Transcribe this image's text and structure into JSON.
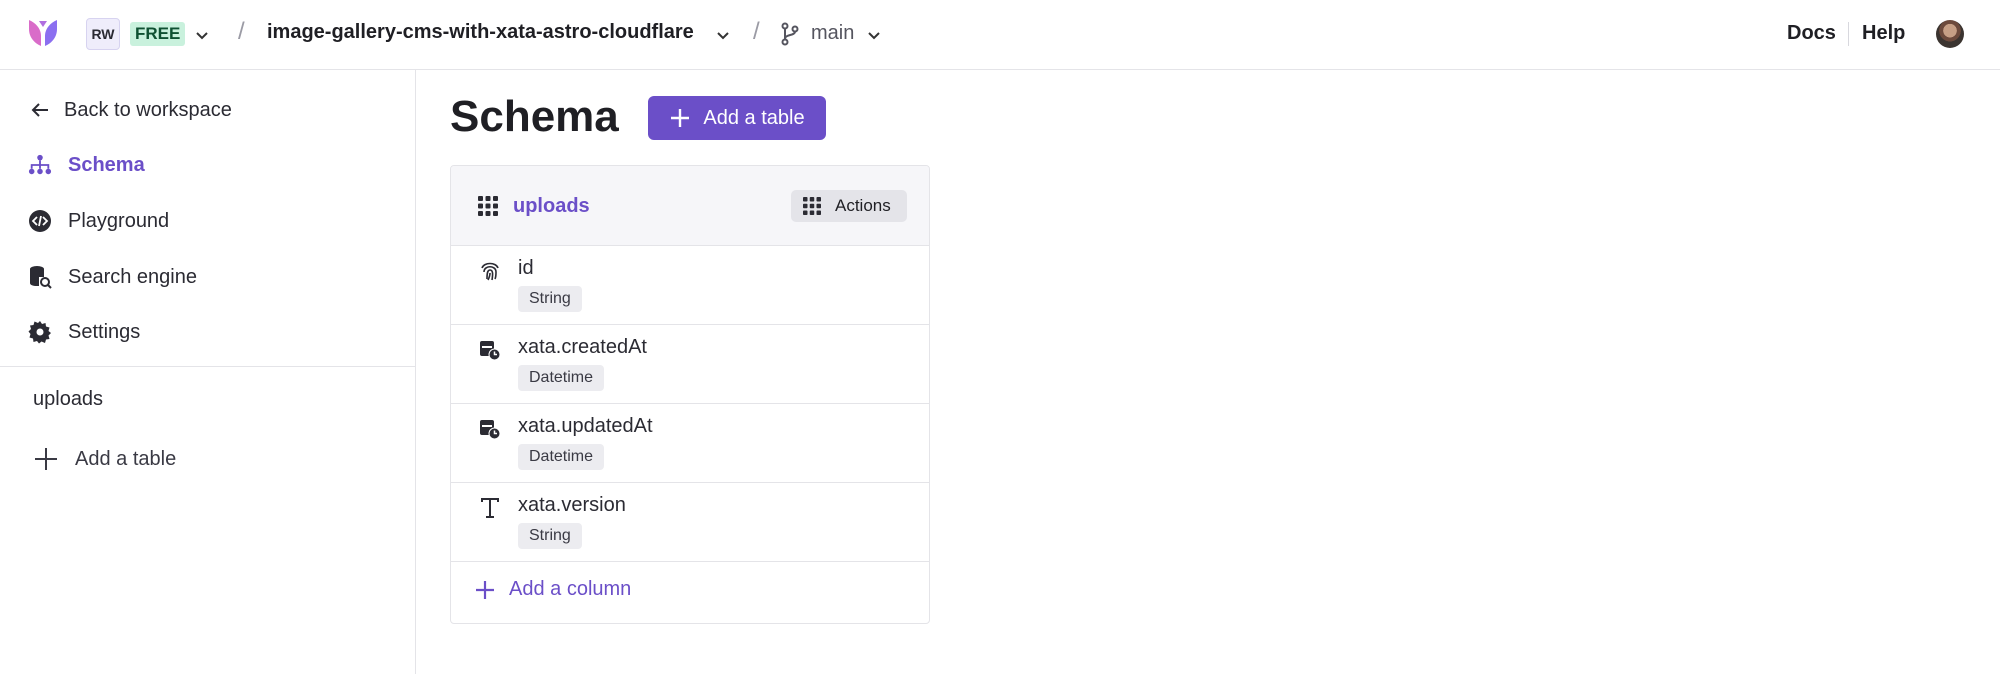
{
  "topbar": {
    "workspace_initials": "RW",
    "plan": "FREE",
    "separator": "/",
    "database": "image-gallery-cms-with-xata-astro-cloudflare",
    "branch": "main",
    "docs": "Docs",
    "help": "Help"
  },
  "sidebar": {
    "back": "Back to workspace",
    "items": [
      {
        "label": "Schema",
        "icon": "schema-icon"
      },
      {
        "label": "Playground",
        "icon": "code-icon"
      },
      {
        "label": "Search engine",
        "icon": "database-search-icon"
      },
      {
        "label": "Settings",
        "icon": "gear-icon"
      }
    ],
    "tables": [
      "uploads"
    ],
    "add_table": "Add a table"
  },
  "main": {
    "title": "Schema",
    "add_table_button": "Add a table",
    "table": {
      "name": "uploads",
      "actions": "Actions",
      "columns": [
        {
          "name": "id",
          "type": "String",
          "icon": "fingerprint-icon"
        },
        {
          "name": "xata.createdAt",
          "type": "Datetime",
          "icon": "calendar-clock-icon"
        },
        {
          "name": "xata.updatedAt",
          "type": "Datetime",
          "icon": "calendar-clock-icon"
        },
        {
          "name": "xata.version",
          "type": "String",
          "icon": "text-type-icon"
        }
      ],
      "add_column": "Add a column"
    }
  },
  "colors": {
    "accent": "#6b4fc8",
    "free_badge": "#c9f1dd"
  }
}
